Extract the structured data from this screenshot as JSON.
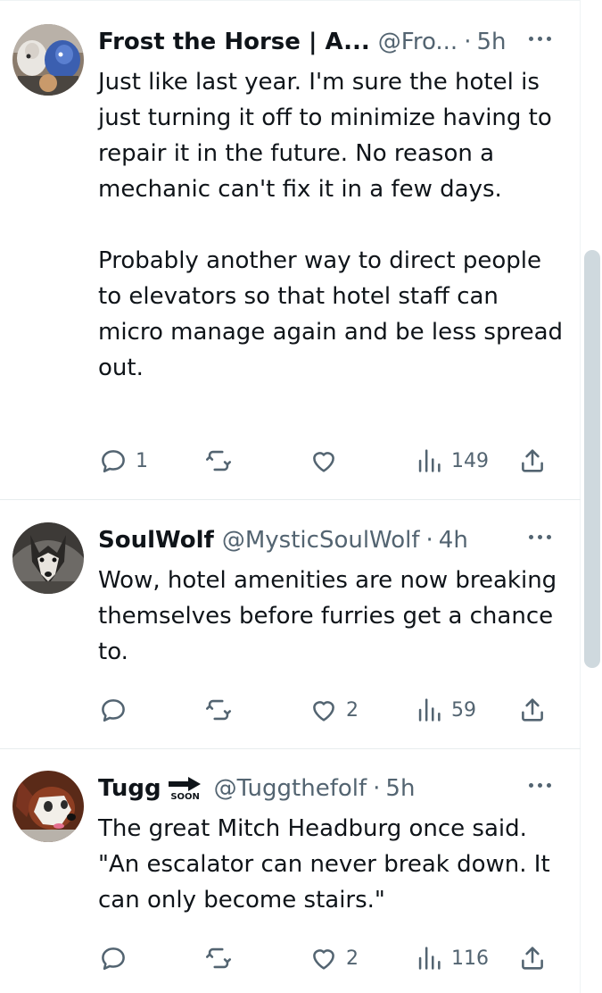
{
  "tweets": [
    {
      "name": "Frost the Horse | A...",
      "handle": "@Fro...",
      "dot": "·",
      "time": "5h",
      "paragraphs": [
        "Just like last year. I'm sure the hotel is just turning it off to minimize having to repair it in the future. No reason a mechanic can't fix it in a few days.",
        "Probably another way to direct people to elevators so that hotel staff can micro manage again and be less spread out."
      ],
      "replies": "1",
      "reposts": "",
      "likes": "",
      "views": "149"
    },
    {
      "name": "SoulWolf",
      "handle": "@MysticSoulWolf",
      "dot": "·",
      "time": "4h",
      "paragraphs": [
        "Wow, hotel amenities are now breaking themselves before furries get a chance to."
      ],
      "replies": "",
      "reposts": "",
      "likes": "2",
      "views": "59"
    },
    {
      "name": "Tugg",
      "badge_text": "SOON",
      "handle": "@Tuggthefolf",
      "dot": "·",
      "time": "5h",
      "paragraphs": [
        "The great Mitch Headburg once said. \"An escalator can never break down. It can only become stairs.\""
      ],
      "replies": "",
      "reposts": "",
      "likes": "2",
      "views": "116"
    }
  ],
  "colors": {
    "text": "#0f1419",
    "secondary": "#536471",
    "divider": "#eff3f4",
    "scrollbar": "#cfd9de"
  },
  "icons": [
    "more-icon",
    "reply-icon",
    "repost-icon",
    "like-icon",
    "views-icon",
    "share-icon",
    "arrow-right-icon"
  ]
}
